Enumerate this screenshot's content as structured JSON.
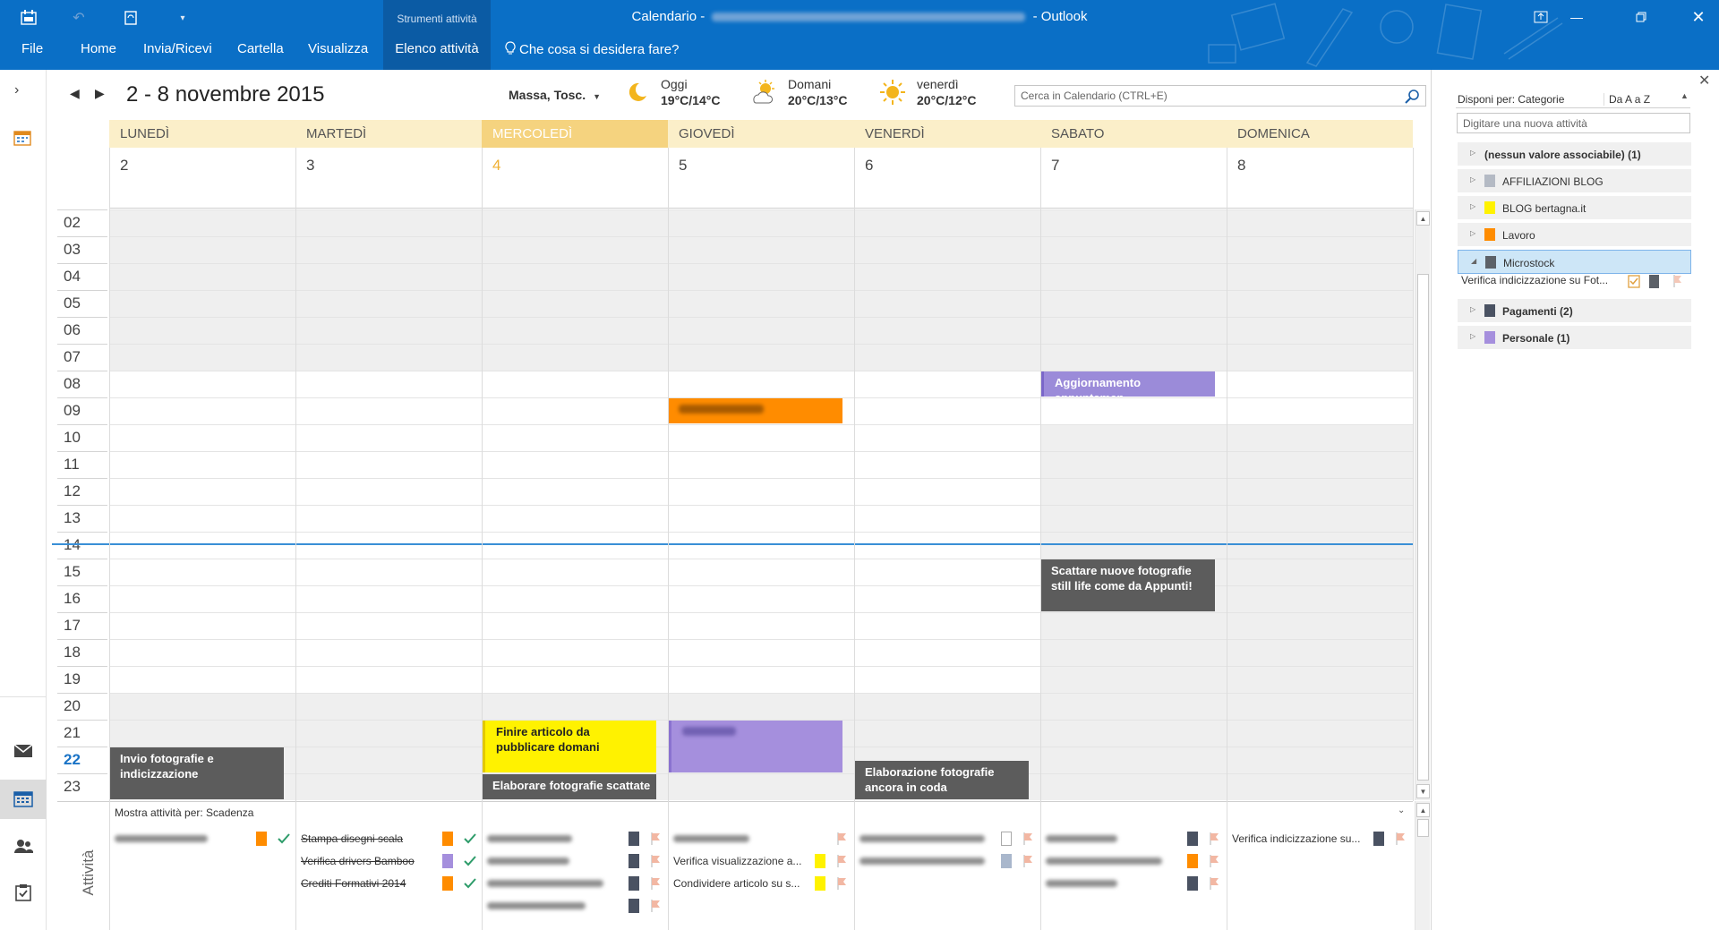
{
  "window": {
    "title_prefix": "Calendario - ",
    "title_suffix": " - Outlook"
  },
  "ribbon": {
    "context_group": "Strumenti attività",
    "tabs": [
      "File",
      "Home",
      "Invia/Ricevi",
      "Cartella",
      "Visualizza",
      "Elenco attività"
    ],
    "tell_me": "Che cosa si desidera fare?"
  },
  "calendar": {
    "date_range": "2 - 8 novembre 2015",
    "location": "Massa, Tosc.",
    "weather": [
      {
        "label": "Oggi",
        "temps": "19°C/14°C",
        "icon": "moon-icon"
      },
      {
        "label": "Domani",
        "temps": "20°C/13°C",
        "icon": "partly-cloudy-icon"
      },
      {
        "label": "venerdì",
        "temps": "20°C/12°C",
        "icon": "sun-icon"
      }
    ],
    "search_placeholder": "Cerca in Calendario (CTRL+E)",
    "days": [
      {
        "name": "LUNEDÌ",
        "num": "2"
      },
      {
        "name": "MARTEDÌ",
        "num": "3"
      },
      {
        "name": "MERCOLEDÌ",
        "num": "4",
        "today": true
      },
      {
        "name": "GIOVEDÌ",
        "num": "5"
      },
      {
        "name": "VENERDÌ",
        "num": "6"
      },
      {
        "name": "SABATO",
        "num": "7"
      },
      {
        "name": "DOMENICA",
        "num": "8"
      }
    ],
    "hours": [
      "02",
      "03",
      "04",
      "05",
      "06",
      "07",
      "08",
      "09",
      "10",
      "11",
      "12",
      "13",
      "14",
      "15",
      "16",
      "17",
      "18",
      "19",
      "20",
      "21",
      "22",
      "23"
    ],
    "current_hour": "22",
    "appointments": [
      {
        "day": 5,
        "title": "Aggiornamento appuntamen",
        "color": "#9b8bd9"
      },
      {
        "day": 3,
        "title": "",
        "color": "#ff8c00"
      },
      {
        "day": 5,
        "title": "Scattare nuove fotografie still life come da Appunti!",
        "color": "#5c5c5c"
      },
      {
        "day": 0,
        "title": "Invio fotografie e indicizzazione",
        "color": "#5c5c5c"
      },
      {
        "day": 2,
        "title": "Finire articolo da pubblicare domani",
        "color": "#fff200"
      },
      {
        "day": 2,
        "title": "Elaborare fotografie scattate",
        "color": "#5c5c5c"
      },
      {
        "day": 3,
        "title": "",
        "color": "#a58fdd"
      },
      {
        "day": 4,
        "title": "Elaborazione fotografie ancora in coda",
        "color": "#5c5c5c"
      }
    ]
  },
  "tasks_strip": {
    "label": "Attività",
    "show_by": "Mostra attività per: Scadenza",
    "columns": [
      [
        {
          "text": "",
          "color": "#ff8c00",
          "status": "done"
        }
      ],
      [
        {
          "text": "Stampa disegni scala",
          "color": "#ff8c00",
          "status": "done",
          "strike": true
        },
        {
          "text": "Verifica drivers Bamboo",
          "color": "#a58fdd",
          "status": "done",
          "strike": true
        },
        {
          "text": "Crediti Formativi 2014",
          "color": "#ff8c00",
          "status": "done",
          "strike": true
        }
      ],
      [
        {
          "text": "",
          "color": "#4a5262",
          "status": "flag"
        },
        {
          "text": "",
          "color": "#4a5262",
          "status": "flag"
        },
        {
          "text": "",
          "color": "#4a5262",
          "status": "flag"
        },
        {
          "text": "",
          "color": "#4a5262",
          "status": "flag"
        }
      ],
      [
        {
          "text": "",
          "color": "",
          "status": "flag"
        },
        {
          "text": "Verifica visualizzazione a...",
          "color": "#fff200",
          "status": "flag"
        },
        {
          "text": "Condividere articolo su s...",
          "color": "#fff200",
          "status": "flag"
        }
      ],
      [
        {
          "text": "",
          "color": "#ffffff",
          "status": "flag"
        },
        {
          "text": "",
          "color": "#a9b7cc",
          "status": "flag"
        }
      ],
      [
        {
          "text": "",
          "color": "#4a5262",
          "status": "flag"
        },
        {
          "text": "",
          "color": "#ff8c00",
          "status": "flag"
        },
        {
          "text": "",
          "color": "#4a5262",
          "status": "flag"
        }
      ],
      [
        {
          "text": "Verifica indicizzazione su...",
          "color": "#4a5262",
          "status": "flag"
        }
      ]
    ]
  },
  "todo_pane": {
    "arrange_by": "Disponi per: Categorie",
    "sort": "Da A a Z",
    "new_task_placeholder": "Digitare una nuova attività",
    "groups": [
      {
        "label": "(nessun valore associabile) (1)",
        "color": "",
        "bold": true
      },
      {
        "label": "AFFILIAZIONI BLOG",
        "color": "#b4bac4"
      },
      {
        "label": "BLOG bertagna.it",
        "color": "#fff200"
      },
      {
        "label": "Lavoro",
        "color": "#ff8c00"
      },
      {
        "label": "Microstock",
        "color": "#5c6168",
        "expanded": true,
        "selected": true
      },
      {
        "label": "Pagamenti (2)",
        "color": "#4a5262",
        "bold": true
      },
      {
        "label": "Personale (1)",
        "color": "#a58fdd",
        "bold": true
      }
    ],
    "expanded_task": "Verifica indicizzazione su Fot..."
  }
}
